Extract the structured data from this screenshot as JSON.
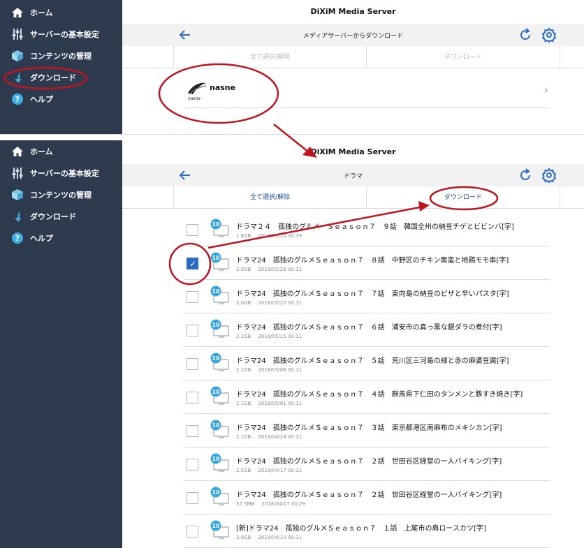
{
  "app_title": "DiXiM Media Server",
  "sidebar": {
    "items": [
      {
        "label": "ホーム",
        "icon": "home-icon"
      },
      {
        "label": "サーバーの基本設定",
        "icon": "sliders-icon"
      },
      {
        "label": "コンテンツの管理",
        "icon": "box-icon"
      },
      {
        "label": "ダウンロード",
        "icon": "download-arrow-icon"
      },
      {
        "label": "ヘルプ",
        "icon": "help-icon"
      }
    ]
  },
  "top_screen": {
    "title": "メディアサーバーからダウンロード",
    "select_all_label": "全て選択/解除",
    "download_label": "ダウンロード",
    "server_name": "nasne",
    "logo_text": "nasne"
  },
  "bottom_screen": {
    "title": "ドラマ",
    "select_all_label": "全て選択/解除",
    "download_label": "ダウンロード",
    "badge": "10",
    "items": [
      {
        "title": "ドラマ２４　孤独のグルメ　Ｓｅａｓｏｎ７　９話　韓国全州の納豆チゲとビビンバ[字]",
        "size": "1.8GB",
        "date": "2018/06/12 00:19",
        "checked": false
      },
      {
        "title": "ドラマ24　孤独のグルメＳｅａｓｏｎ７　８話　中野区のチキン南蛮と地鶏モモ串[字]",
        "size": "2.0GB",
        "date": "2018/05/29 00:11",
        "checked": true
      },
      {
        "title": "ドラマ24　孤独のグルメＳｅａｓｏｎ７　７話　東向島の納豆のピザと辛いパスタ[字]",
        "size": "2.0GB",
        "date": "2018/05/22 00:11",
        "checked": false
      },
      {
        "title": "ドラマ24　孤独のグルメＳｅａｓｏｎ７　６話　浦安市の真っ黒な銀ダラの煮付[字]",
        "size": "2.1GB",
        "date": "2018/05/15 00:11",
        "checked": false
      },
      {
        "title": "ドラマ24　孤独のグルメＳｅａｓｏｎ７　５話　荒川区三河島の緑と赤の麻婆豆腐[字]",
        "size": "2.1GB",
        "date": "2018/05/08 00:11",
        "checked": false
      },
      {
        "title": "ドラマ24　孤独のグルメＳｅａｓｏｎ７　４話　群馬県下仁田のタンメンと豚すき焼き[字]",
        "size": "2.1GB",
        "date": "2018/05/01 00:11",
        "checked": false
      },
      {
        "title": "ドラマ24　孤独のグルメＳｅａｓｏｎ７　３話　東京都港区南麻布のメキシカン[字]",
        "size": "2.1GB",
        "date": "2018/04/24 00:11",
        "checked": false
      },
      {
        "title": "ドラマ24　孤独のグルメＳｅａｓｏｎ７　２話　世田谷区経堂の一人バイキング[字]",
        "size": "2.5GB",
        "date": "2018/04/17 00:31",
        "checked": false
      },
      {
        "title": "ドラマ24　孤独のグルメＳｅａｓｏｎ７　２話　世田谷区経堂の一人バイキング[字]",
        "size": "57.5MB",
        "date": "2018/04/17 00:29",
        "checked": false
      },
      {
        "title": "[新]ドラマ24　孤独のグルメＳｅａｓｏｎ７　１話　上尾市の肩ロースカツ[字]",
        "size": "2.0GB",
        "date": "2018/04/10 00:11",
        "checked": false
      }
    ]
  },
  "colors": {
    "sidebar_bg": "#2e3a4e",
    "accent": "#2a6bbf",
    "annotation": "#c0141e"
  }
}
